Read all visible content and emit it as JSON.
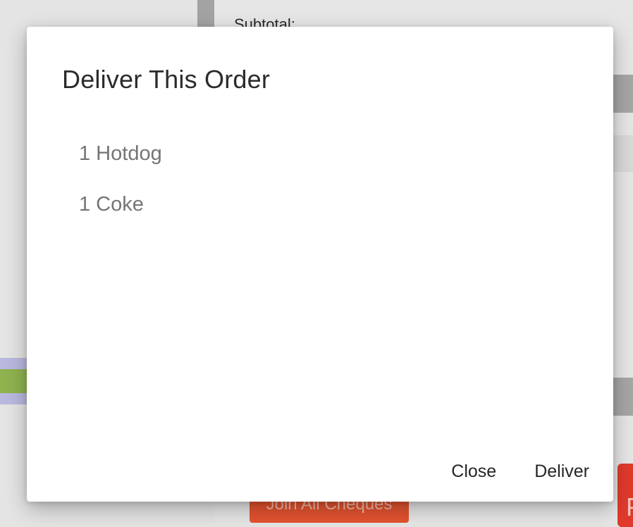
{
  "background": {
    "subtotal_label": "Subtotal:",
    "join_button_label": "Join All Cheques",
    "right_button_label": "P"
  },
  "dialog": {
    "title": "Deliver This Order",
    "items": [
      {
        "label": "1 Hotdog"
      },
      {
        "label": "1 Coke"
      }
    ],
    "close_label": "Close",
    "deliver_label": "Deliver"
  }
}
